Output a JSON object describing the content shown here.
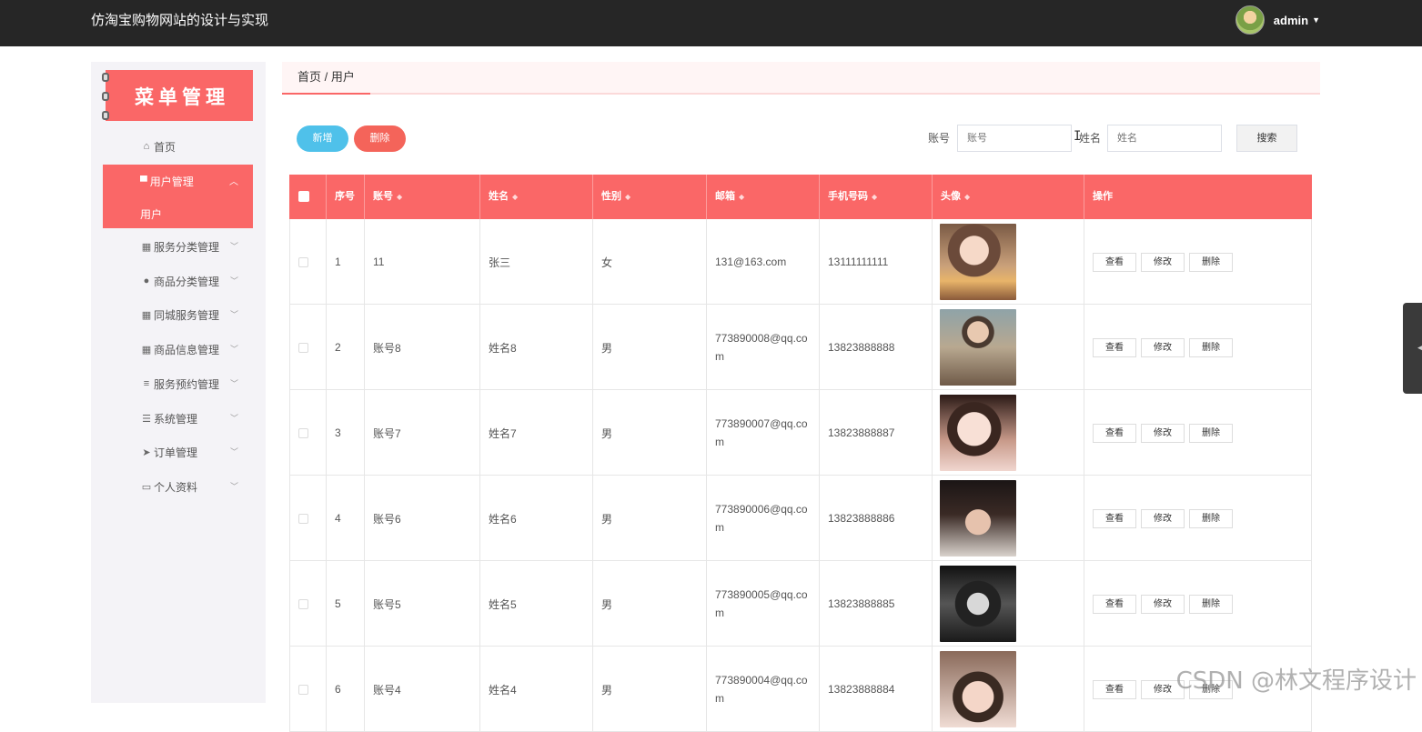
{
  "app": {
    "title": "仿淘宝购物网站的设计与实现",
    "username": "admin"
  },
  "sidebar": {
    "header": "菜单管理",
    "items": [
      {
        "label": "首页",
        "icon": "home-icon"
      },
      {
        "label": "用户管理",
        "icon": "monitor-icon",
        "active": true,
        "sub": "用户"
      },
      {
        "label": "服务分类管理",
        "icon": "grid-icon"
      },
      {
        "label": "商品分类管理",
        "icon": "person-icon"
      },
      {
        "label": "同城服务管理",
        "icon": "grid-icon"
      },
      {
        "label": "商品信息管理",
        "icon": "grid-icon"
      },
      {
        "label": "服务预约管理",
        "icon": "list-icon"
      },
      {
        "label": "系统管理",
        "icon": "sliders-icon"
      },
      {
        "label": "订单管理",
        "icon": "send-icon"
      },
      {
        "label": "个人资料",
        "icon": "card-icon"
      }
    ]
  },
  "breadcrumb": "首页 / 用户",
  "toolbar": {
    "add_label": "新增",
    "delete_label": "删除",
    "account_label": "账号",
    "account_placeholder": "账号",
    "name_label": "姓名",
    "name_placeholder": "姓名",
    "search_label": "搜索"
  },
  "table": {
    "columns": [
      "序号",
      "账号",
      "姓名",
      "性别",
      "邮箱",
      "手机号码",
      "头像",
      "操作"
    ],
    "actions": {
      "view": "查看",
      "edit": "修改",
      "delete": "删除"
    },
    "rows": [
      {
        "no": "1",
        "account": "11",
        "name": "张三",
        "gender": "女",
        "email": "131@163.com",
        "phone": "13111111111"
      },
      {
        "no": "2",
        "account": "账号8",
        "name": "姓名8",
        "gender": "男",
        "email": "773890008@qq.com",
        "phone": "13823888888"
      },
      {
        "no": "3",
        "account": "账号7",
        "name": "姓名7",
        "gender": "男",
        "email": "773890007@qq.com",
        "phone": "13823888887"
      },
      {
        "no": "4",
        "account": "账号6",
        "name": "姓名6",
        "gender": "男",
        "email": "773890006@qq.com",
        "phone": "13823888886"
      },
      {
        "no": "5",
        "account": "账号5",
        "name": "姓名5",
        "gender": "男",
        "email": "773890005@qq.com",
        "phone": "13823888885"
      },
      {
        "no": "6",
        "account": "账号4",
        "name": "姓名4",
        "gender": "男",
        "email": "773890004@qq.com",
        "phone": "13823888884"
      }
    ]
  },
  "watermark": "CSDN @林文程序设计"
}
